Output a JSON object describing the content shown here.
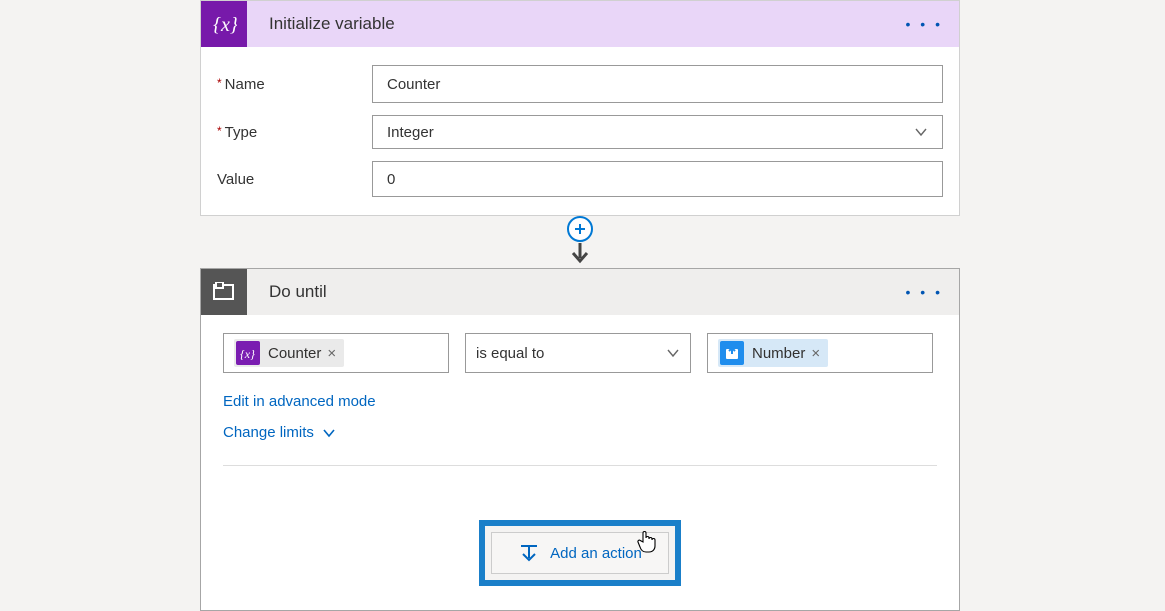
{
  "card1": {
    "title": "Initialize variable",
    "fields": {
      "name_label": "Name",
      "name_value": "Counter",
      "type_label": "Type",
      "type_value": "Integer",
      "value_label": "Value",
      "value_value": "0"
    }
  },
  "card2": {
    "title": "Do until",
    "condition": {
      "left_token": "Counter",
      "operator": "is equal to",
      "right_token": "Number"
    },
    "links": {
      "advanced": "Edit in advanced mode",
      "limits": "Change limits"
    },
    "add_action_label": "Add an action"
  }
}
